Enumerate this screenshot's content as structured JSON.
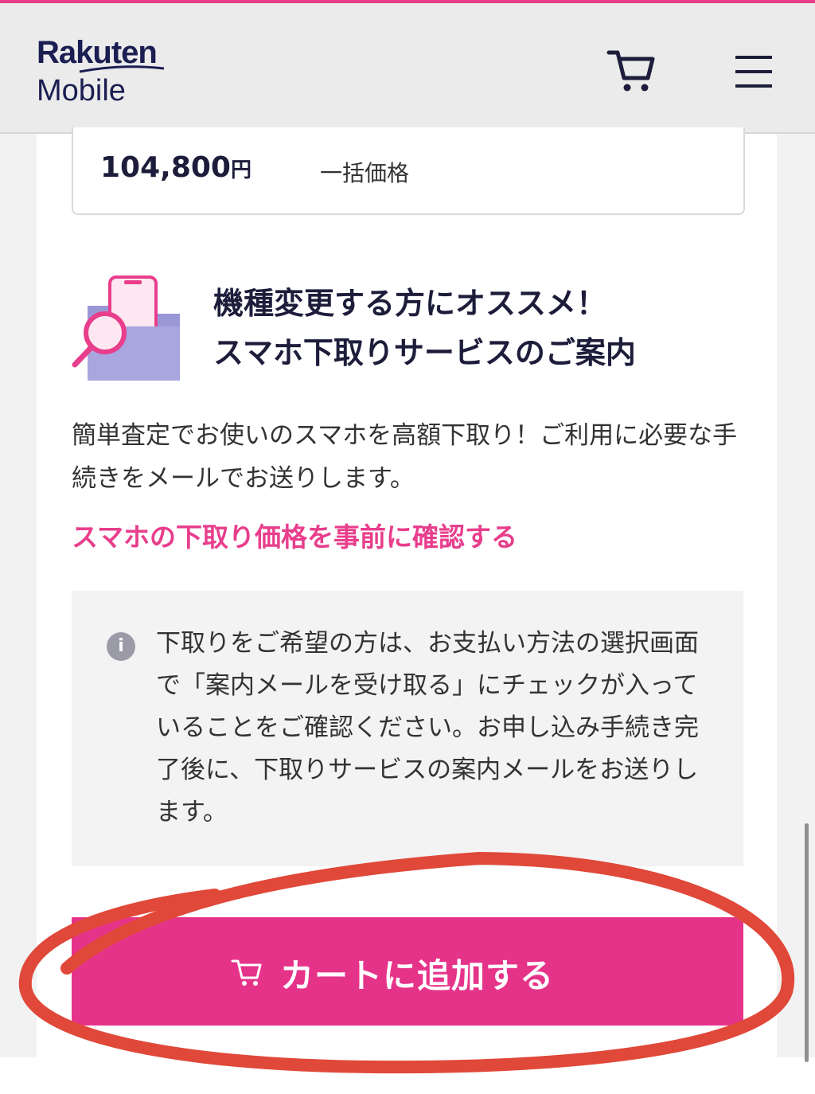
{
  "header": {
    "logo_top": "Rakuten",
    "logo_bottom": "Mobile",
    "cart_icon": "cart-icon",
    "menu_icon": "hamburger-menu-icon"
  },
  "price": {
    "amount": "104,800",
    "unit": "円",
    "label": "一括価格"
  },
  "trade_in": {
    "icon": "phone-search-icon",
    "title_line1": "機種変更する方にオススメ！",
    "title_line2": "スマホ下取りサービスのご案内",
    "description": "簡単査定でお使いのスマホを高額下取り！ご利用に必要な手続きをメールでお送りします。",
    "link": "スマホの下取り価格を事前に確認する"
  },
  "notice": {
    "icon": "info-icon",
    "icon_glyph": "i",
    "text": "下取りをご希望の方は、お支払い方法の選択画面で「案内メールを受け取る」にチェックが入っていることをご確認ください。お申し込み手続き完了後に、下取りサービスの案内メールをお送りします。"
  },
  "cart_button": {
    "label": "カートに追加する",
    "icon": "cart-icon"
  },
  "colors": {
    "brand_pink": "#e6338a",
    "link_pink": "#e83e8c",
    "annotation_red": "#e0483a",
    "navy": "#1b1e52"
  }
}
